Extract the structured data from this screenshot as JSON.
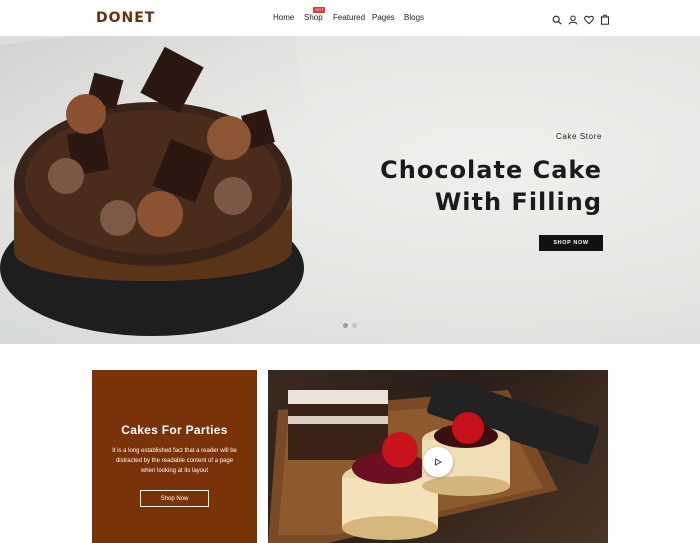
{
  "brand": {
    "logo": "DONET"
  },
  "nav": {
    "items": [
      {
        "label": "Home"
      },
      {
        "label": "Shop",
        "badge": "HOT"
      },
      {
        "label": "Featured"
      },
      {
        "label": "Pages"
      },
      {
        "label": "Blogs"
      }
    ]
  },
  "header_icons": [
    "search-icon",
    "user-icon",
    "heart-icon",
    "bag-icon"
  ],
  "hero": {
    "subtitle": "Cake Store",
    "title_line1": "Chocolate Cake",
    "title_line2": "With Filling",
    "button_label": "SHOP NOW",
    "slides": 2,
    "active_slide": 1
  },
  "promo": {
    "title": "Cakes For Parties",
    "text": "It is a long established fact that a reader will be distracted by the readable content of a page when looking at its layout",
    "button_label": "Shop Now"
  },
  "colors": {
    "brand": "#6b2d0c",
    "promo_bg": "#7a3208",
    "hot_badge": "#e5322d",
    "button_dark": "#111111"
  }
}
